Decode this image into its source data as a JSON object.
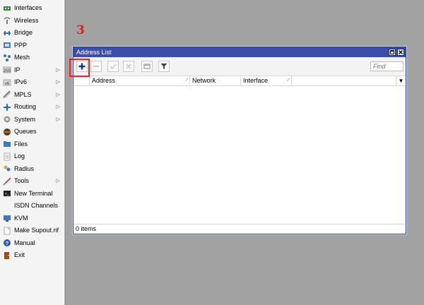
{
  "sidebar": {
    "items": [
      {
        "label": "Interfaces",
        "icon": "interfaces-icon",
        "submenu": false
      },
      {
        "label": "Wireless",
        "icon": "wireless-icon",
        "submenu": false
      },
      {
        "label": "Bridge",
        "icon": "bridge-icon",
        "submenu": false
      },
      {
        "label": "PPP",
        "icon": "ppp-icon",
        "submenu": false
      },
      {
        "label": "Mesh",
        "icon": "mesh-icon",
        "submenu": false
      },
      {
        "label": "IP",
        "icon": "ip-icon",
        "submenu": true
      },
      {
        "label": "IPv6",
        "icon": "ipv6-icon",
        "submenu": true
      },
      {
        "label": "MPLS",
        "icon": "mpls-icon",
        "submenu": true
      },
      {
        "label": "Routing",
        "icon": "routing-icon",
        "submenu": true
      },
      {
        "label": "System",
        "icon": "system-icon",
        "submenu": true
      },
      {
        "label": "Queues",
        "icon": "queues-icon",
        "submenu": false
      },
      {
        "label": "Files",
        "icon": "files-icon",
        "submenu": false
      },
      {
        "label": "Log",
        "icon": "log-icon",
        "submenu": false
      },
      {
        "label": "Radius",
        "icon": "radius-icon",
        "submenu": false
      },
      {
        "label": "Tools",
        "icon": "tools-icon",
        "submenu": true
      },
      {
        "label": "New Terminal",
        "icon": "terminal-icon",
        "submenu": false
      },
      {
        "label": "ISDN Channels",
        "icon": "",
        "submenu": false
      },
      {
        "label": "KVM",
        "icon": "kvm-icon",
        "submenu": false
      },
      {
        "label": "Make Supout.rif",
        "icon": "supout-icon",
        "submenu": false
      },
      {
        "label": "Manual",
        "icon": "manual-icon",
        "submenu": false
      },
      {
        "label": "Exit",
        "icon": "exit-icon",
        "submenu": false
      }
    ]
  },
  "annotation": {
    "step": "3"
  },
  "window": {
    "title": "Address List",
    "toolbar": {
      "add": "add-icon",
      "remove": "remove-icon",
      "enable": "enable-icon",
      "disable": "disable-icon",
      "comment": "comment-icon",
      "filter": "filter-icon"
    },
    "find_placeholder": "Find",
    "columns": [
      "Address",
      "Network",
      "Interface"
    ],
    "rows": [],
    "status": "0 items"
  },
  "colors": {
    "title_bar": "#3b4fa8",
    "workspace": "#a2a2a2",
    "highlight": "#e0262a",
    "annotation": "#e51b1b"
  }
}
